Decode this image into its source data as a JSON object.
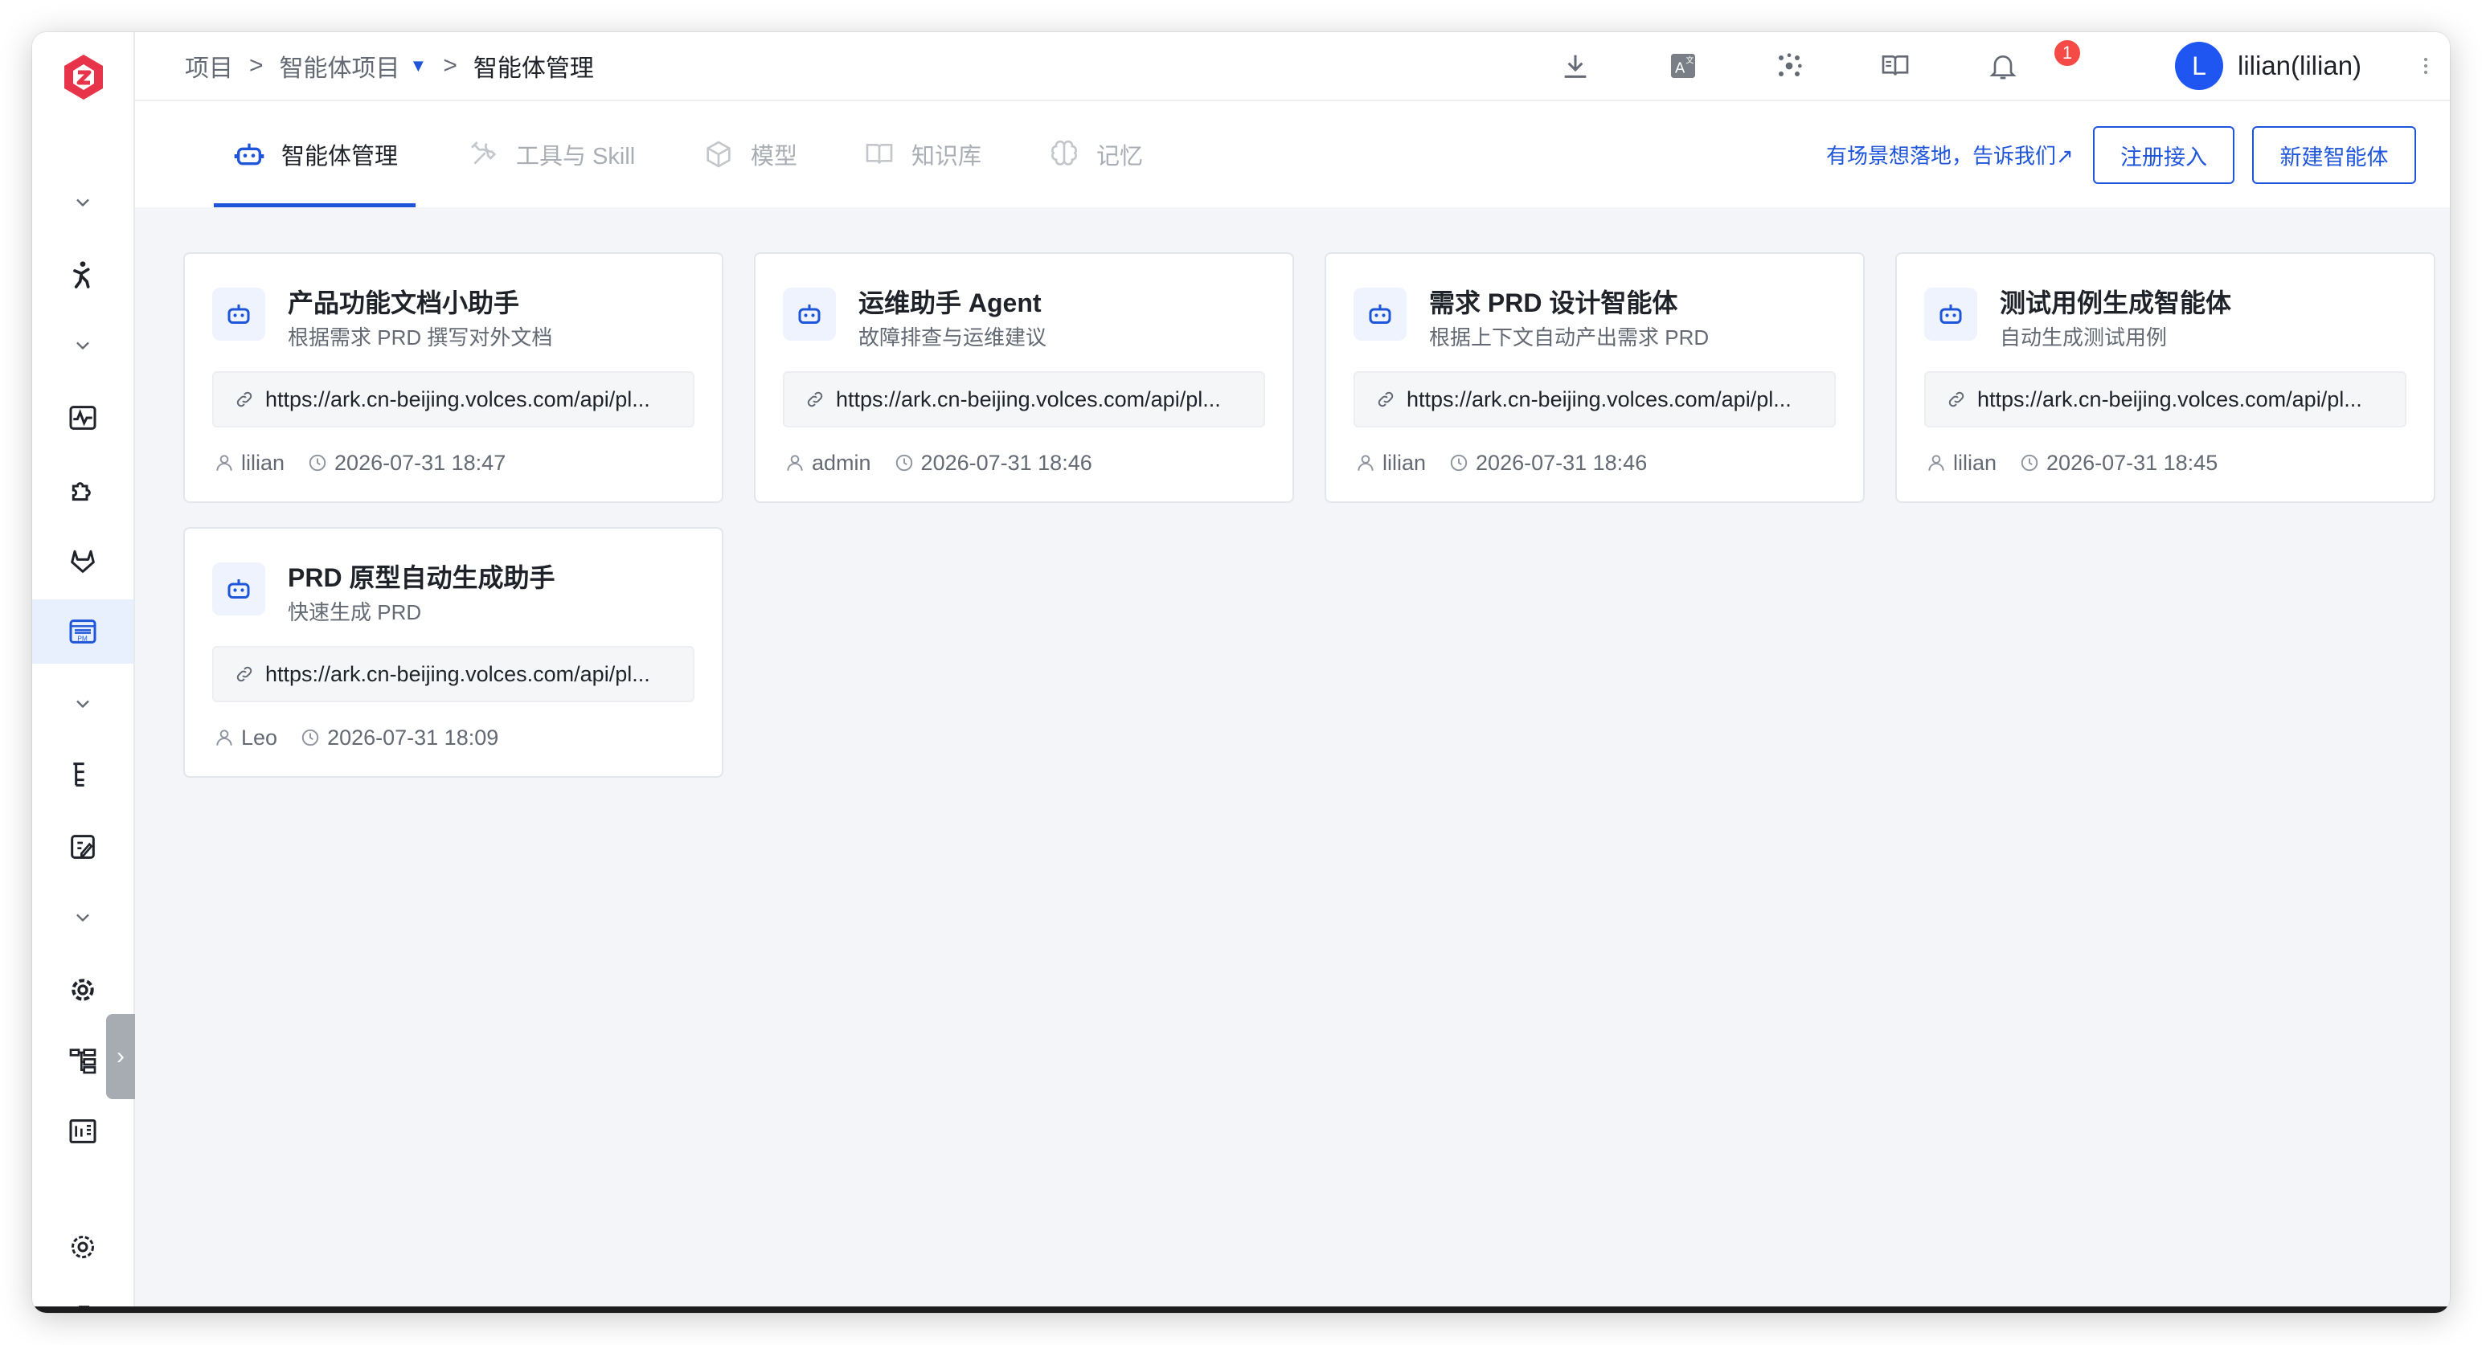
{
  "header": {
    "breadcrumb": {
      "root": "项目",
      "sep1": ">",
      "project": "智能体项目",
      "sep2": ">",
      "current": "智能体管理"
    },
    "notification_count": "1",
    "user": {
      "avatar_letter": "L",
      "name": "lilian(lilian)"
    }
  },
  "tabs": [
    {
      "label": "智能体管理",
      "icon": "robot-icon",
      "active": true
    },
    {
      "label": "工具与 Skill",
      "icon": "tools-icon",
      "active": false
    },
    {
      "label": "模型",
      "icon": "cube-icon",
      "active": false
    },
    {
      "label": "知识库",
      "icon": "book-icon",
      "active": false
    },
    {
      "label": "记忆",
      "icon": "brain-icon",
      "active": false
    }
  ],
  "actions": {
    "feedback_link": "有场景想落地，告诉我们↗",
    "register_button": "注册接入",
    "create_button": "新建智能体"
  },
  "agents": [
    {
      "title": "产品功能文档小助手",
      "desc": "根据需求 PRD 撰写对外文档",
      "url": "https://ark.cn-beijing.volces.com/api/pl...",
      "owner": "lilian",
      "time": "2026-07-31 18:47"
    },
    {
      "title": "运维助手 Agent",
      "desc": "故障排查与运维建议",
      "url": "https://ark.cn-beijing.volces.com/api/pl...",
      "owner": "admin",
      "time": "2026-07-31 18:46"
    },
    {
      "title": "需求 PRD 设计智能体",
      "desc": "根据上下文自动产出需求 PRD",
      "url": "https://ark.cn-beijing.volces.com/api/pl...",
      "owner": "lilian",
      "time": "2026-07-31 18:46"
    },
    {
      "title": "测试用例生成智能体",
      "desc": "自动生成测试用例",
      "url": "https://ark.cn-beijing.volces.com/api/pl...",
      "owner": "lilian",
      "time": "2026-07-31 18:45"
    },
    {
      "title": "PRD 原型自动生成助手",
      "desc": "快速生成 PRD",
      "url": "https://ark.cn-beijing.volces.com/api/pl...",
      "owner": "Leo",
      "time": "2026-07-31 18:09"
    }
  ],
  "colors": {
    "accent": "#1f55d9",
    "badge": "#f54a45",
    "avatar": "#1f55f0",
    "logo": "#e8344a"
  }
}
